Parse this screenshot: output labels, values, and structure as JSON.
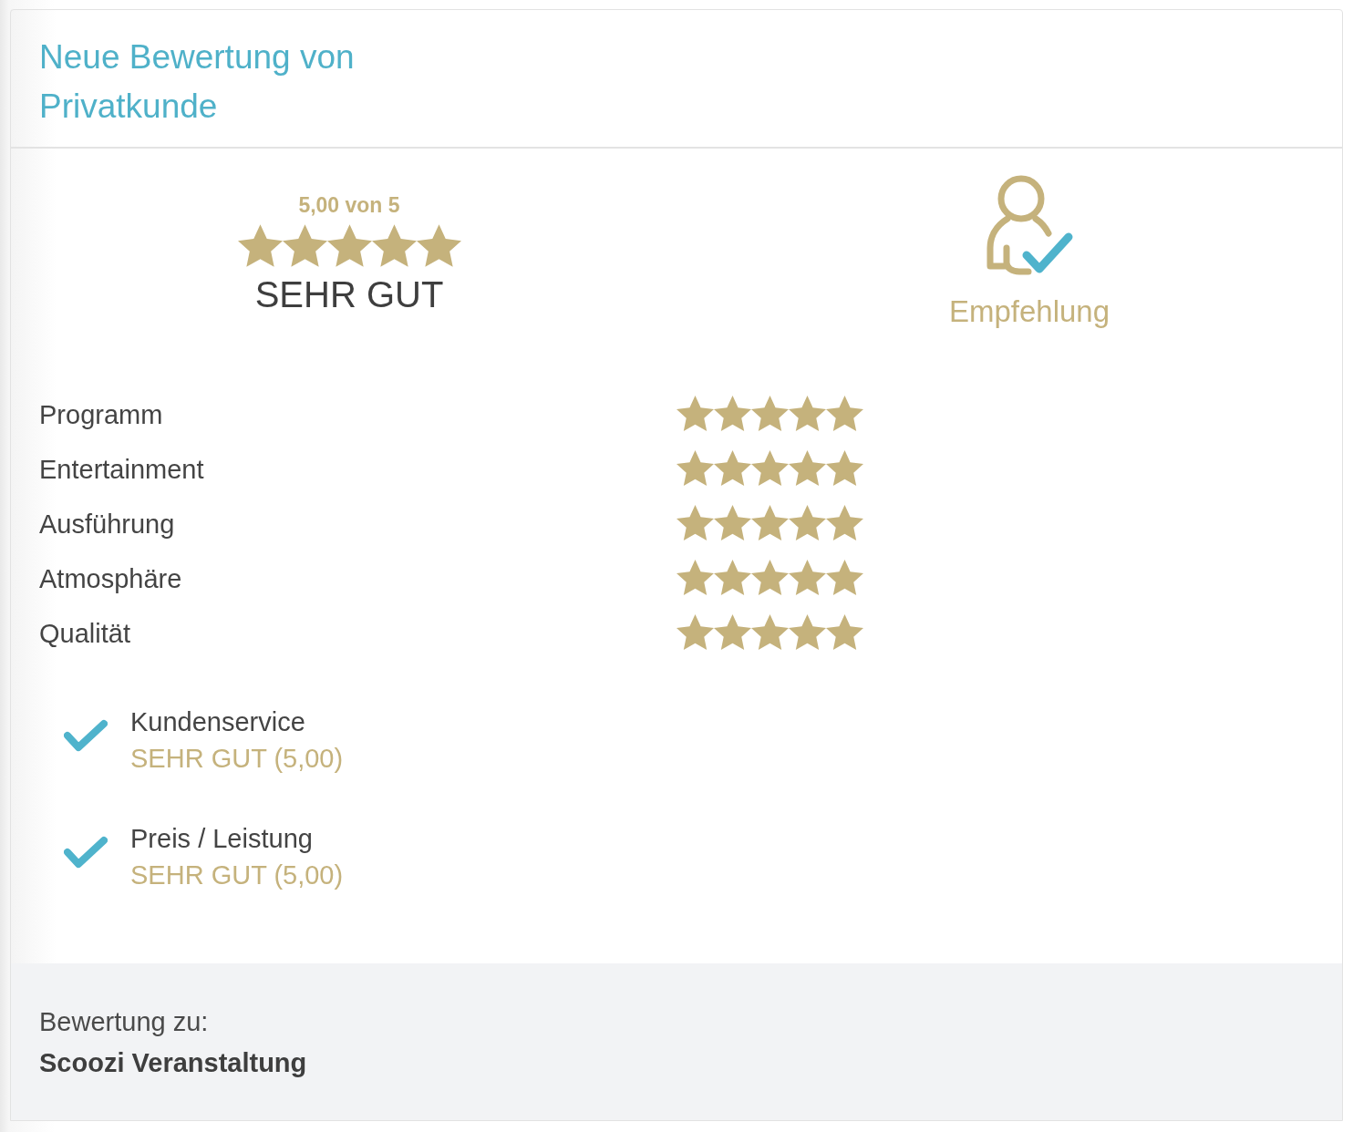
{
  "header": {
    "title": "Neue Bewertung von Privatkunde"
  },
  "overall": {
    "score": "5,00 von 5",
    "stars": 5,
    "verdict": "SEHR GUT"
  },
  "recommendation": {
    "label": "Empfehlung"
  },
  "criteria": [
    {
      "label": "Programm",
      "stars": 5
    },
    {
      "label": "Entertainment",
      "stars": 5
    },
    {
      "label": "Ausführung",
      "stars": 5
    },
    {
      "label": "Atmosphäre",
      "stars": 5
    },
    {
      "label": "Qualität",
      "stars": 5
    }
  ],
  "extras": [
    {
      "label": "Kundenservice",
      "value": "SEHR GUT (5,00)",
      "checked": true
    },
    {
      "label": "Preis / Leistung",
      "value": "SEHR GUT (5,00)",
      "checked": true
    }
  ],
  "footer": {
    "caption": "Bewertung zu:",
    "subject": "Scoozi Veranstaltung"
  }
}
